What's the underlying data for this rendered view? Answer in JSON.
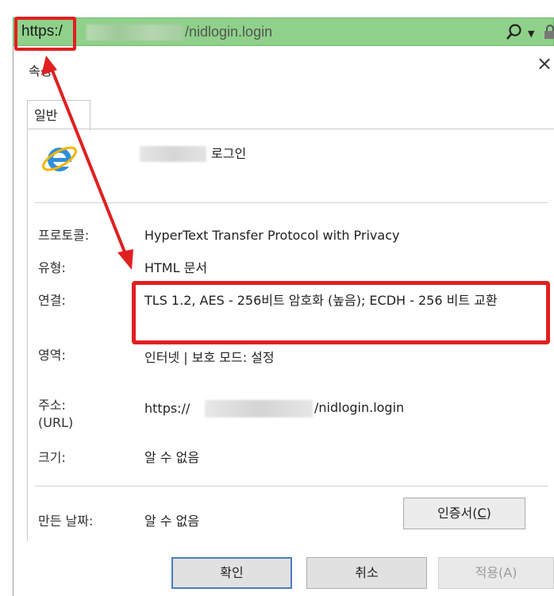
{
  "address_bar": {
    "scheme": "https:/",
    "path": "/nidlogin.login",
    "icons": [
      "search-icon",
      "chevron-down-icon",
      "lock-icon"
    ]
  },
  "dialog": {
    "title": "속성",
    "close_glyph": "×",
    "tab": "일반",
    "page_name": "로그인",
    "fields": {
      "protocol_label": "프로토콜:",
      "protocol_value": "HyperText Transfer Protocol with Privacy",
      "type_label": "유형:",
      "type_value": "HTML 문서",
      "connection_label": "연결:",
      "connection_value": "TLS 1.2, AES - 256비트 암호화 (높음); ECDH - 256 비트 교환",
      "zone_label": "영역:",
      "zone_value": "인터넷 | 보호 모드: 설정",
      "address_label_line1": "주소:",
      "address_label_line2": "(URL)",
      "address_value_prefix": "https://",
      "address_value_suffix": "/nidlogin.login",
      "size_label": "크기:",
      "size_value": "알 수 없음",
      "created_label": "만든 날짜:",
      "created_value": "알 수 없음"
    },
    "buttons": {
      "certificate_main": "인증서(",
      "certificate_key": "C",
      "certificate_end": ")",
      "ok": "확인",
      "cancel": "취소",
      "apply": "적용(A)"
    }
  },
  "annotation": {
    "highlight_color": "#e02020"
  }
}
